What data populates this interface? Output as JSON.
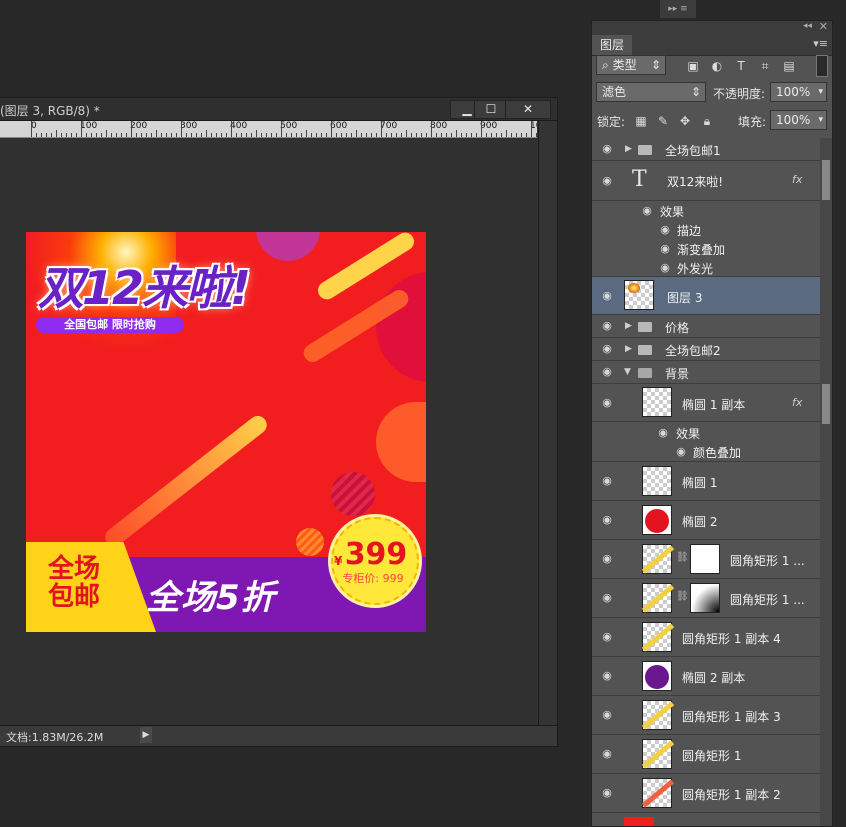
{
  "document": {
    "title": "(图层 3, RGB/8) *",
    "status": "文档:1.83M/26.2M",
    "ruler_ticks": [
      "0",
      "100",
      "200",
      "300",
      "400",
      "500",
      "600",
      "700",
      "800",
      "900",
      "10"
    ],
    "window_buttons": [
      "▁",
      "☐",
      "✕"
    ]
  },
  "artwork": {
    "headline": "双12来啦!",
    "tagline": "全国包邮 限时抢购",
    "badge_line1": "全场",
    "badge_line2": "包邮",
    "discount": "全场5折",
    "price_symbol": "¥",
    "price": "399",
    "original_price": "专柜价: 999"
  },
  "layers_panel": {
    "tab": "图层",
    "filter_type": "类型",
    "blend_mode": "滤色",
    "opacity_label": "不透明度:",
    "opacity_value": "100%",
    "lock_label": "锁定:",
    "fill_label": "填充:",
    "fill_value": "100%",
    "layers": [
      {
        "name": "全场包邮1",
        "kind": "group"
      },
      {
        "name": "双12来啦!",
        "kind": "text",
        "fx": true
      },
      {
        "name": "效果",
        "kind": "effect-header"
      },
      {
        "name": "描边",
        "kind": "effect"
      },
      {
        "name": "渐变叠加",
        "kind": "effect"
      },
      {
        "name": "外发光",
        "kind": "effect"
      },
      {
        "name": "图层 3",
        "kind": "layer",
        "selected": true
      },
      {
        "name": "价格",
        "kind": "group"
      },
      {
        "name": "全场包邮2",
        "kind": "group"
      },
      {
        "name": "背景",
        "kind": "group-open"
      },
      {
        "name": "椭圆 1 副本",
        "kind": "shape",
        "fx": true
      },
      {
        "name": "效果",
        "kind": "effect-header"
      },
      {
        "name": "颜色叠加",
        "kind": "effect"
      },
      {
        "name": "椭圆 1",
        "kind": "shape"
      },
      {
        "name": "椭圆 2",
        "kind": "shape"
      },
      {
        "name": "圆角矩形 1 ...",
        "kind": "masked"
      },
      {
        "name": "圆角矩形 1 ...",
        "kind": "masked"
      },
      {
        "name": "圆角矩形 1 副本 4",
        "kind": "shape"
      },
      {
        "name": "椭圆 2 副本",
        "kind": "shape"
      },
      {
        "name": "圆角矩形 1 副本 3",
        "kind": "shape"
      },
      {
        "name": "圆角矩形 1",
        "kind": "shape"
      },
      {
        "name": "圆角矩形 1 副本 2",
        "kind": "shape"
      }
    ],
    "fx_label": "fx"
  },
  "colors": {
    "art_red": "#f21d1f",
    "art_purple": "#7f17b3",
    "art_yellow": "#ffd317",
    "selected_row": "#5a6a80"
  }
}
